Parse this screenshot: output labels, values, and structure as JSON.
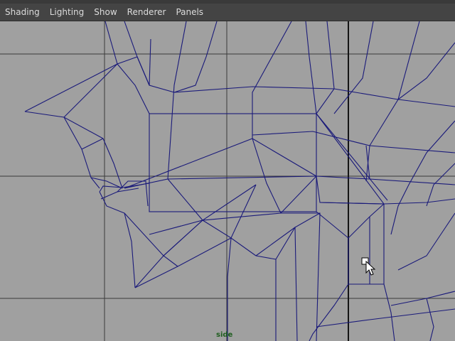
{
  "menu": {
    "items": [
      {
        "label": "Shading"
      },
      {
        "label": "Lighting"
      },
      {
        "label": "Show"
      },
      {
        "label": "Renderer"
      },
      {
        "label": "Panels"
      }
    ]
  },
  "viewport": {
    "camera_label": "side",
    "background_color": "#a0a0a0",
    "grid_color": "#2d2d2d",
    "wire_color": "#1a1a7a",
    "camera_label_color": "#1f5e1f"
  },
  "cursor": {
    "icon": "move-tool-cursor-icon"
  }
}
